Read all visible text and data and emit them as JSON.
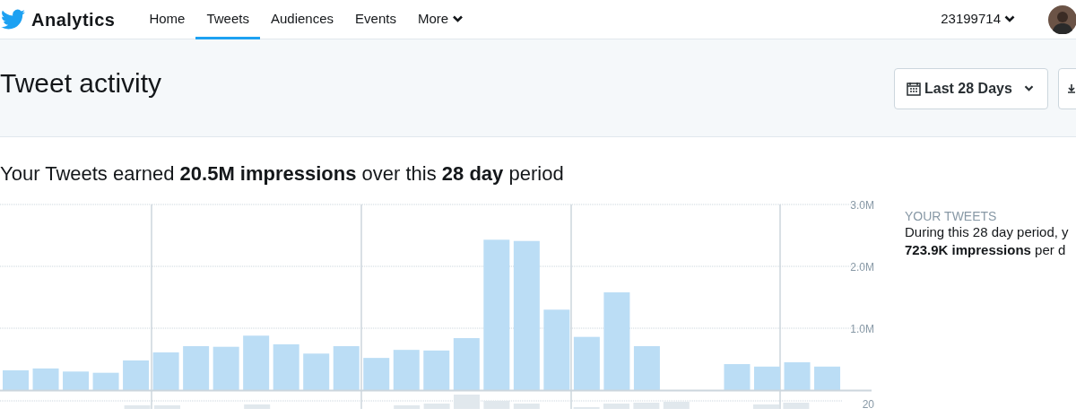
{
  "header": {
    "logo_text": "Analytics",
    "account": "23199714",
    "nav": [
      {
        "label": "Home",
        "selected": false,
        "kind": "link"
      },
      {
        "label": "Tweets",
        "selected": true,
        "kind": "link"
      },
      {
        "label": "Audiences",
        "selected": false,
        "kind": "link"
      },
      {
        "label": "Events",
        "selected": false,
        "kind": "link"
      },
      {
        "label": "More",
        "selected": false,
        "kind": "dropdown"
      }
    ]
  },
  "page_title": "Tweet activity",
  "date_range_button": "Last 28 Days",
  "summary": "Your Tweets earned **20.5M impressions** over this **28 day** period",
  "impressions_chart": {
    "chart_data": {
      "type": "bar",
      "grid": true,
      "ylim": [
        0,
        3000000
      ],
      "yticks": [
        {
          "value": 1000000,
          "label": "1.0M"
        },
        {
          "value": 2000000,
          "label": "2.0M"
        },
        {
          "value": 3000000,
          "label": "3.0M"
        }
      ],
      "values": [
        320000,
        350000,
        300000,
        280000,
        480000,
        610000,
        710000,
        700000,
        880000,
        740000,
        590000,
        710000,
        520000,
        650000,
        640000,
        840000,
        2430000,
        2410000,
        1300000,
        860000,
        1580000,
        710000,
        0,
        0,
        420000,
        380000,
        450000,
        380000,
        null
      ]
    }
  },
  "engagements_chart": {
    "tick": "20"
  },
  "side_panel": {
    "heading": "YOUR TWEETS",
    "lines": [
      "During this 28 day period, y",
      "**723.9K impressions** per d"
    ]
  }
}
